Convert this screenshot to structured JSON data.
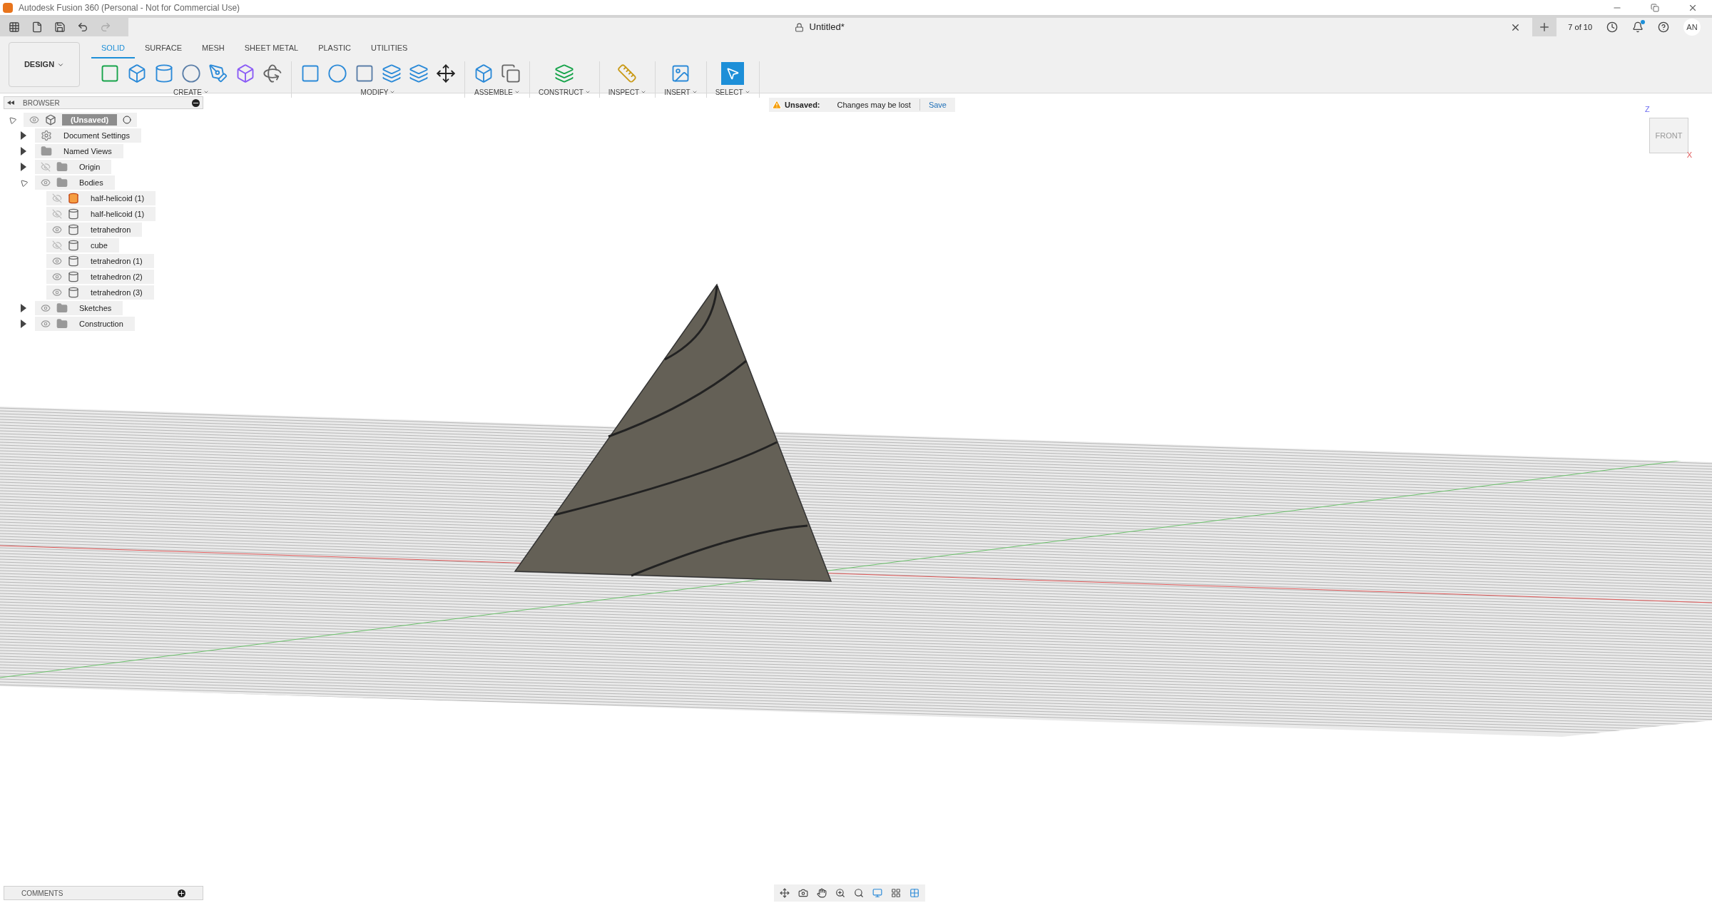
{
  "window": {
    "title": "Autodesk Fusion 360 (Personal - Not for Commercial Use)"
  },
  "document_tab": {
    "title": "Untitled*",
    "version": "7 of 10",
    "avatar": "AN",
    "notification_unread": true
  },
  "toolbar": {
    "workspace": "DESIGN",
    "tabs": [
      {
        "label": "SOLID",
        "selected": true
      },
      {
        "label": "SURFACE",
        "selected": false
      },
      {
        "label": "MESH",
        "selected": false
      },
      {
        "label": "SHEET METAL",
        "selected": false
      },
      {
        "label": "PLASTIC",
        "selected": false
      },
      {
        "label": "UTILITIES",
        "selected": false
      }
    ],
    "groups": [
      {
        "label": "CREATE",
        "kind": "create"
      },
      {
        "label": "MODIFY",
        "kind": "modify"
      },
      {
        "label": "ASSEMBLE",
        "kind": "assemble"
      },
      {
        "label": "CONSTRUCT",
        "kind": "construct"
      },
      {
        "label": "INSPECT",
        "kind": "inspect"
      },
      {
        "label": "INSERT",
        "kind": "insert"
      },
      {
        "label": "SELECT",
        "kind": "select"
      }
    ]
  },
  "notice": {
    "label": "Unsaved:",
    "message": "Changes may be lost",
    "action": "Save"
  },
  "browser": {
    "title": "BROWSER",
    "tree": [
      {
        "label": "(Unsaved)",
        "kind": "root",
        "visible": true,
        "expanded": true,
        "children": [
          {
            "label": "Document Settings",
            "kind": "settings",
            "expanded": false
          },
          {
            "label": "Named Views",
            "kind": "folder",
            "expanded": false
          },
          {
            "label": "Origin",
            "kind": "folder",
            "visible": false,
            "expanded": false
          },
          {
            "label": "Bodies",
            "kind": "folder",
            "visible": true,
            "expanded": true,
            "children": [
              {
                "label": "half-helicoid (1)",
                "kind": "component",
                "visible": false
              },
              {
                "label": "half-helicoid (1)",
                "kind": "body",
                "visible": false
              },
              {
                "label": "tetrahedron",
                "kind": "body",
                "visible": true
              },
              {
                "label": "cube",
                "kind": "body",
                "visible": false
              },
              {
                "label": "tetrahedron (1)",
                "kind": "body",
                "visible": true
              },
              {
                "label": "tetrahedron (2)",
                "kind": "body",
                "visible": true
              },
              {
                "label": "tetrahedron (3)",
                "kind": "body",
                "visible": true
              }
            ]
          },
          {
            "label": "Sketches",
            "kind": "folder",
            "visible": true,
            "expanded": false
          },
          {
            "label": "Construction",
            "kind": "folder",
            "visible": true,
            "expanded": false
          }
        ]
      }
    ]
  },
  "viewcube": {
    "face": "FRONT",
    "axis_z": "Z",
    "axis_x": "X"
  },
  "comments": {
    "title": "COMMENTS"
  }
}
